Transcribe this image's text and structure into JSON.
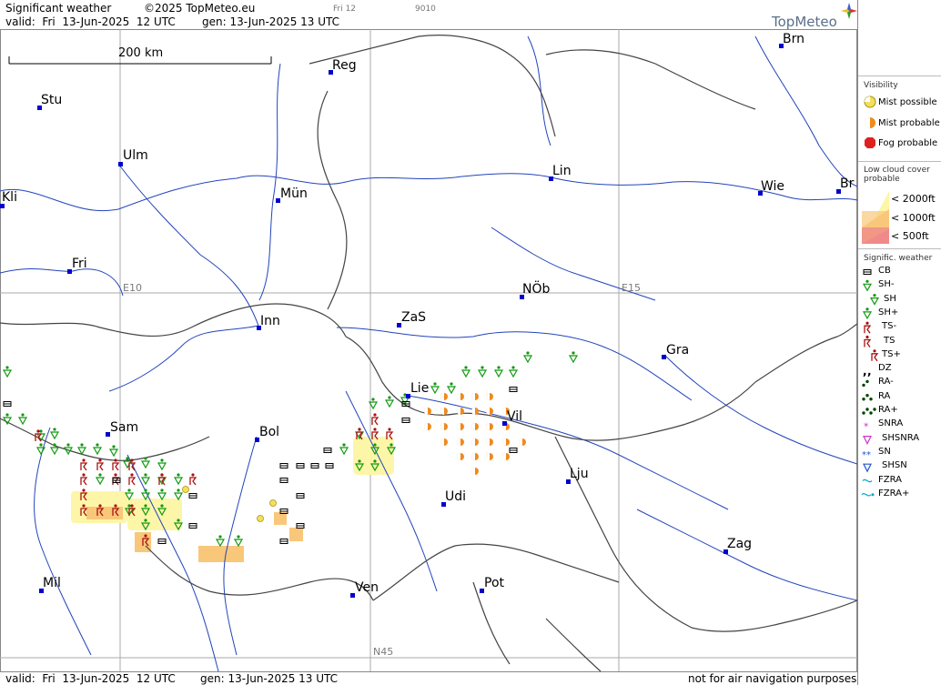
{
  "header": {
    "title": "Significant weather",
    "copyright": "©2025 TopMeteo.eu",
    "valid": "valid:  Fri  13-Jun-2025  12 UTC",
    "gen": "gen: 13-Jun-2025 13 UTC",
    "small_day": "Fri 12",
    "small_code": "9010",
    "logo": "TopMeteo"
  },
  "scale_bar": {
    "label": "200 km"
  },
  "grid_labels": {
    "e10": "E10",
    "e15": "E15",
    "n45": "N45"
  },
  "cities": [
    {
      "name": "Brn"
    },
    {
      "name": "Reg"
    },
    {
      "name": "Stu"
    },
    {
      "name": "Ulm"
    },
    {
      "name": "Lin"
    },
    {
      "name": "Wie"
    },
    {
      "name": "Br"
    },
    {
      "name": "Kli"
    },
    {
      "name": "Mün"
    },
    {
      "name": "Fri"
    },
    {
      "name": "NÖb"
    },
    {
      "name": "Inn"
    },
    {
      "name": "ZaS"
    },
    {
      "name": "Gra"
    },
    {
      "name": "Lie"
    },
    {
      "name": "Vil"
    },
    {
      "name": "Sam"
    },
    {
      "name": "Bol"
    },
    {
      "name": "Lju"
    },
    {
      "name": "Udi"
    },
    {
      "name": "Zag"
    },
    {
      "name": "Mil"
    },
    {
      "name": "Ven"
    },
    {
      "name": "Pot"
    }
  ],
  "legend": {
    "visibility_title": "Visibility",
    "mist_possible": "Mist possible",
    "mist_probable": "Mist probable",
    "fog_probable": "Fog probable",
    "low_cloud_title": "Low cloud cover probable",
    "lc_2000": "< 2000ft",
    "lc_1000": "< 1000ft",
    "lc_500": "<   500ft",
    "sigwx_title": "Signific. weather",
    "items": [
      "CB",
      "SH-",
      "SH",
      "SH+",
      "TS-",
      "TS",
      "TS+",
      "DZ",
      "RA-",
      "RA",
      "RA+",
      "SNRA",
      "SHSNRA",
      "SN",
      "SHSN",
      "FZRA",
      "FZRA+"
    ]
  },
  "footer": {
    "valid": "valid:  Fri  13-Jun-2025  12 UTC",
    "gen": "gen: 13-Jun-2025 13 UTC",
    "note": "not for air navigation purposes"
  },
  "colors": {
    "river": "#2244bb",
    "border": "#444444",
    "grid": "#aaaaaa",
    "city": "#0000cc",
    "mist_possible": "#f0e060",
    "mist_probable": "#f08a1e",
    "fog_probable": "#e02020",
    "lowcloud_2000": "#fdf6a8",
    "lowcloud_1000": "#f9c77a",
    "lowcloud_500": "#f08a8a",
    "shower": "#119911",
    "thunder": "#aa1111"
  }
}
